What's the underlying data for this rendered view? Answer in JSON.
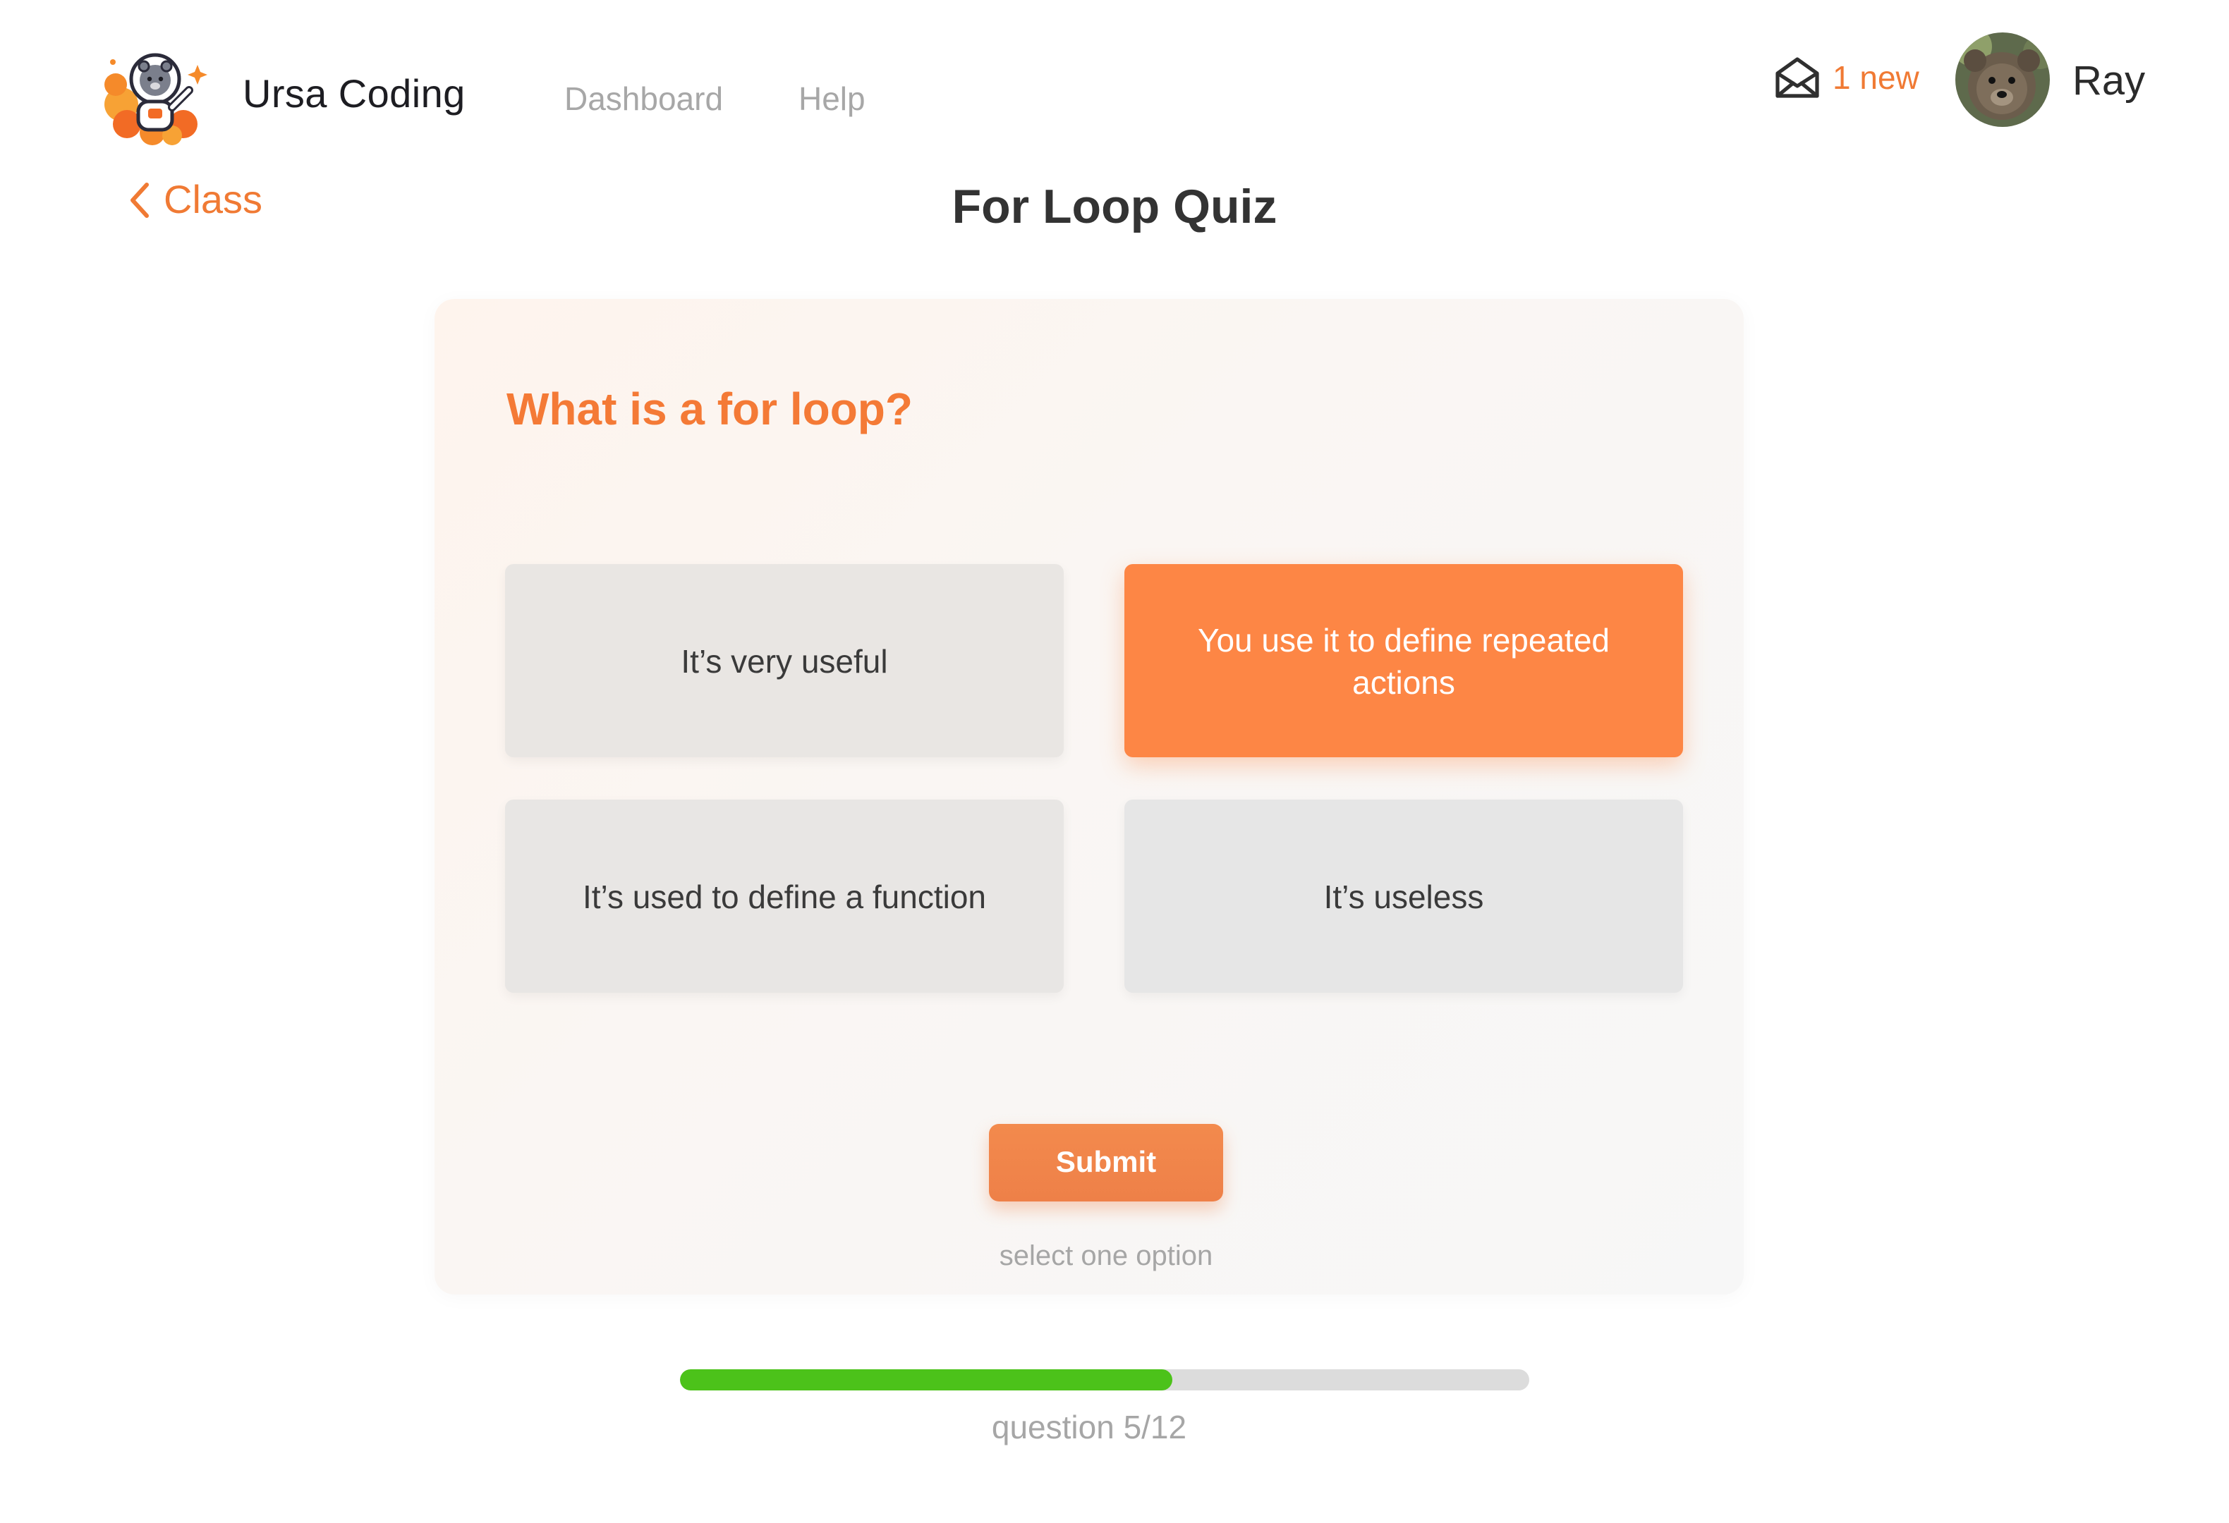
{
  "app": {
    "brand": "Ursa Coding"
  },
  "nav": {
    "items": [
      {
        "label": "Dashboard"
      },
      {
        "label": "Help"
      }
    ]
  },
  "notifications": {
    "icon": "mail-open-icon",
    "label": "1 new"
  },
  "user": {
    "name": "Ray"
  },
  "back": {
    "label": "Class",
    "icon": "chevron-left-icon"
  },
  "page": {
    "title": "For Loop Quiz"
  },
  "quiz": {
    "question": "What is a for loop?",
    "options": [
      {
        "label": "It’s very useful",
        "selected": false
      },
      {
        "label": "You use it to define repeated actions",
        "selected": true
      },
      {
        "label": "It’s used to define a function",
        "selected": false
      },
      {
        "label": "It’s useless",
        "selected": false
      }
    ],
    "submit_label": "Submit",
    "hint": "select one option"
  },
  "progress": {
    "current": 5,
    "total": 12,
    "fraction": 0.58,
    "label": "question 5/12"
  },
  "colors": {
    "accent": "#f47a36",
    "selected_option": "#fd8645",
    "progress": "#4cc21a"
  }
}
